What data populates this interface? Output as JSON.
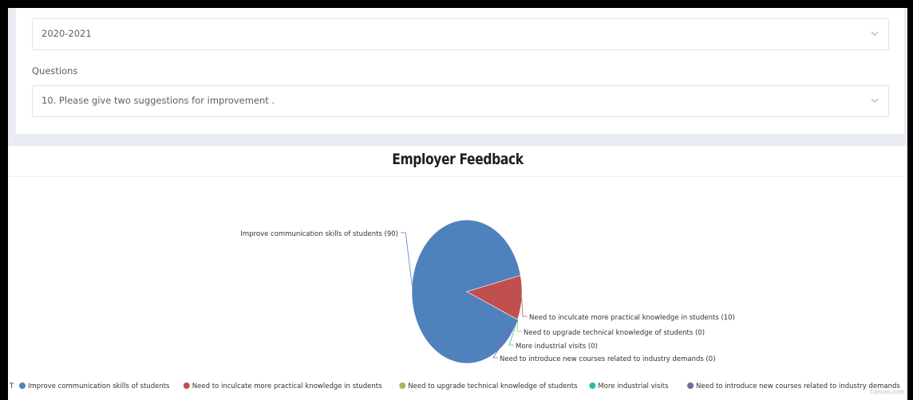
{
  "filters": {
    "year_value": "2020-2021",
    "questions_label": "Questions",
    "question_value": "10. Please give two suggestions for improvement ."
  },
  "chart_data": {
    "type": "pie",
    "title": "Employer Feedback",
    "categories": [
      "Improve communication skills of students",
      "Need to inculcate more practical knowledge in students",
      "Need to upgrade technical knowledge of students",
      "More industrial visits",
      "Need to introduce new courses related to industry demands"
    ],
    "values": [
      90,
      10,
      0,
      0,
      0
    ],
    "colors": [
      "#4f81bd",
      "#c0504d",
      "#9bbb59",
      "#23bfaa",
      "#8064a2"
    ],
    "legend_position": "bottom",
    "legend_clip_prefix": "T"
  },
  "credit": "Canvas.com"
}
